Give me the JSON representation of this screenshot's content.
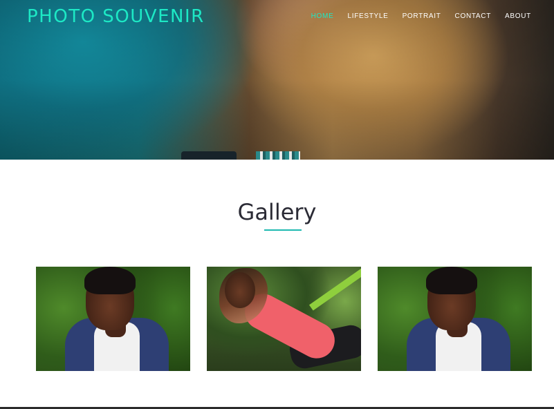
{
  "site": {
    "brand": "PHOTO SOUVENIR",
    "nav": [
      {
        "label": "HOME",
        "active": true
      },
      {
        "label": "LIFESTYLE",
        "active": false
      },
      {
        "label": "PORTRAIT",
        "active": false
      },
      {
        "label": "CONTACT",
        "active": false
      },
      {
        "label": "ABOUT",
        "active": false
      }
    ]
  },
  "gallery": {
    "title": "Gallery",
    "items": [
      {
        "subject": "man-portrait"
      },
      {
        "subject": "woman-portrait"
      },
      {
        "subject": "man-portrait"
      }
    ]
  },
  "colors": {
    "accent": "#1de9c5",
    "rule": "#1db9b0",
    "title": "#2b2b35"
  }
}
